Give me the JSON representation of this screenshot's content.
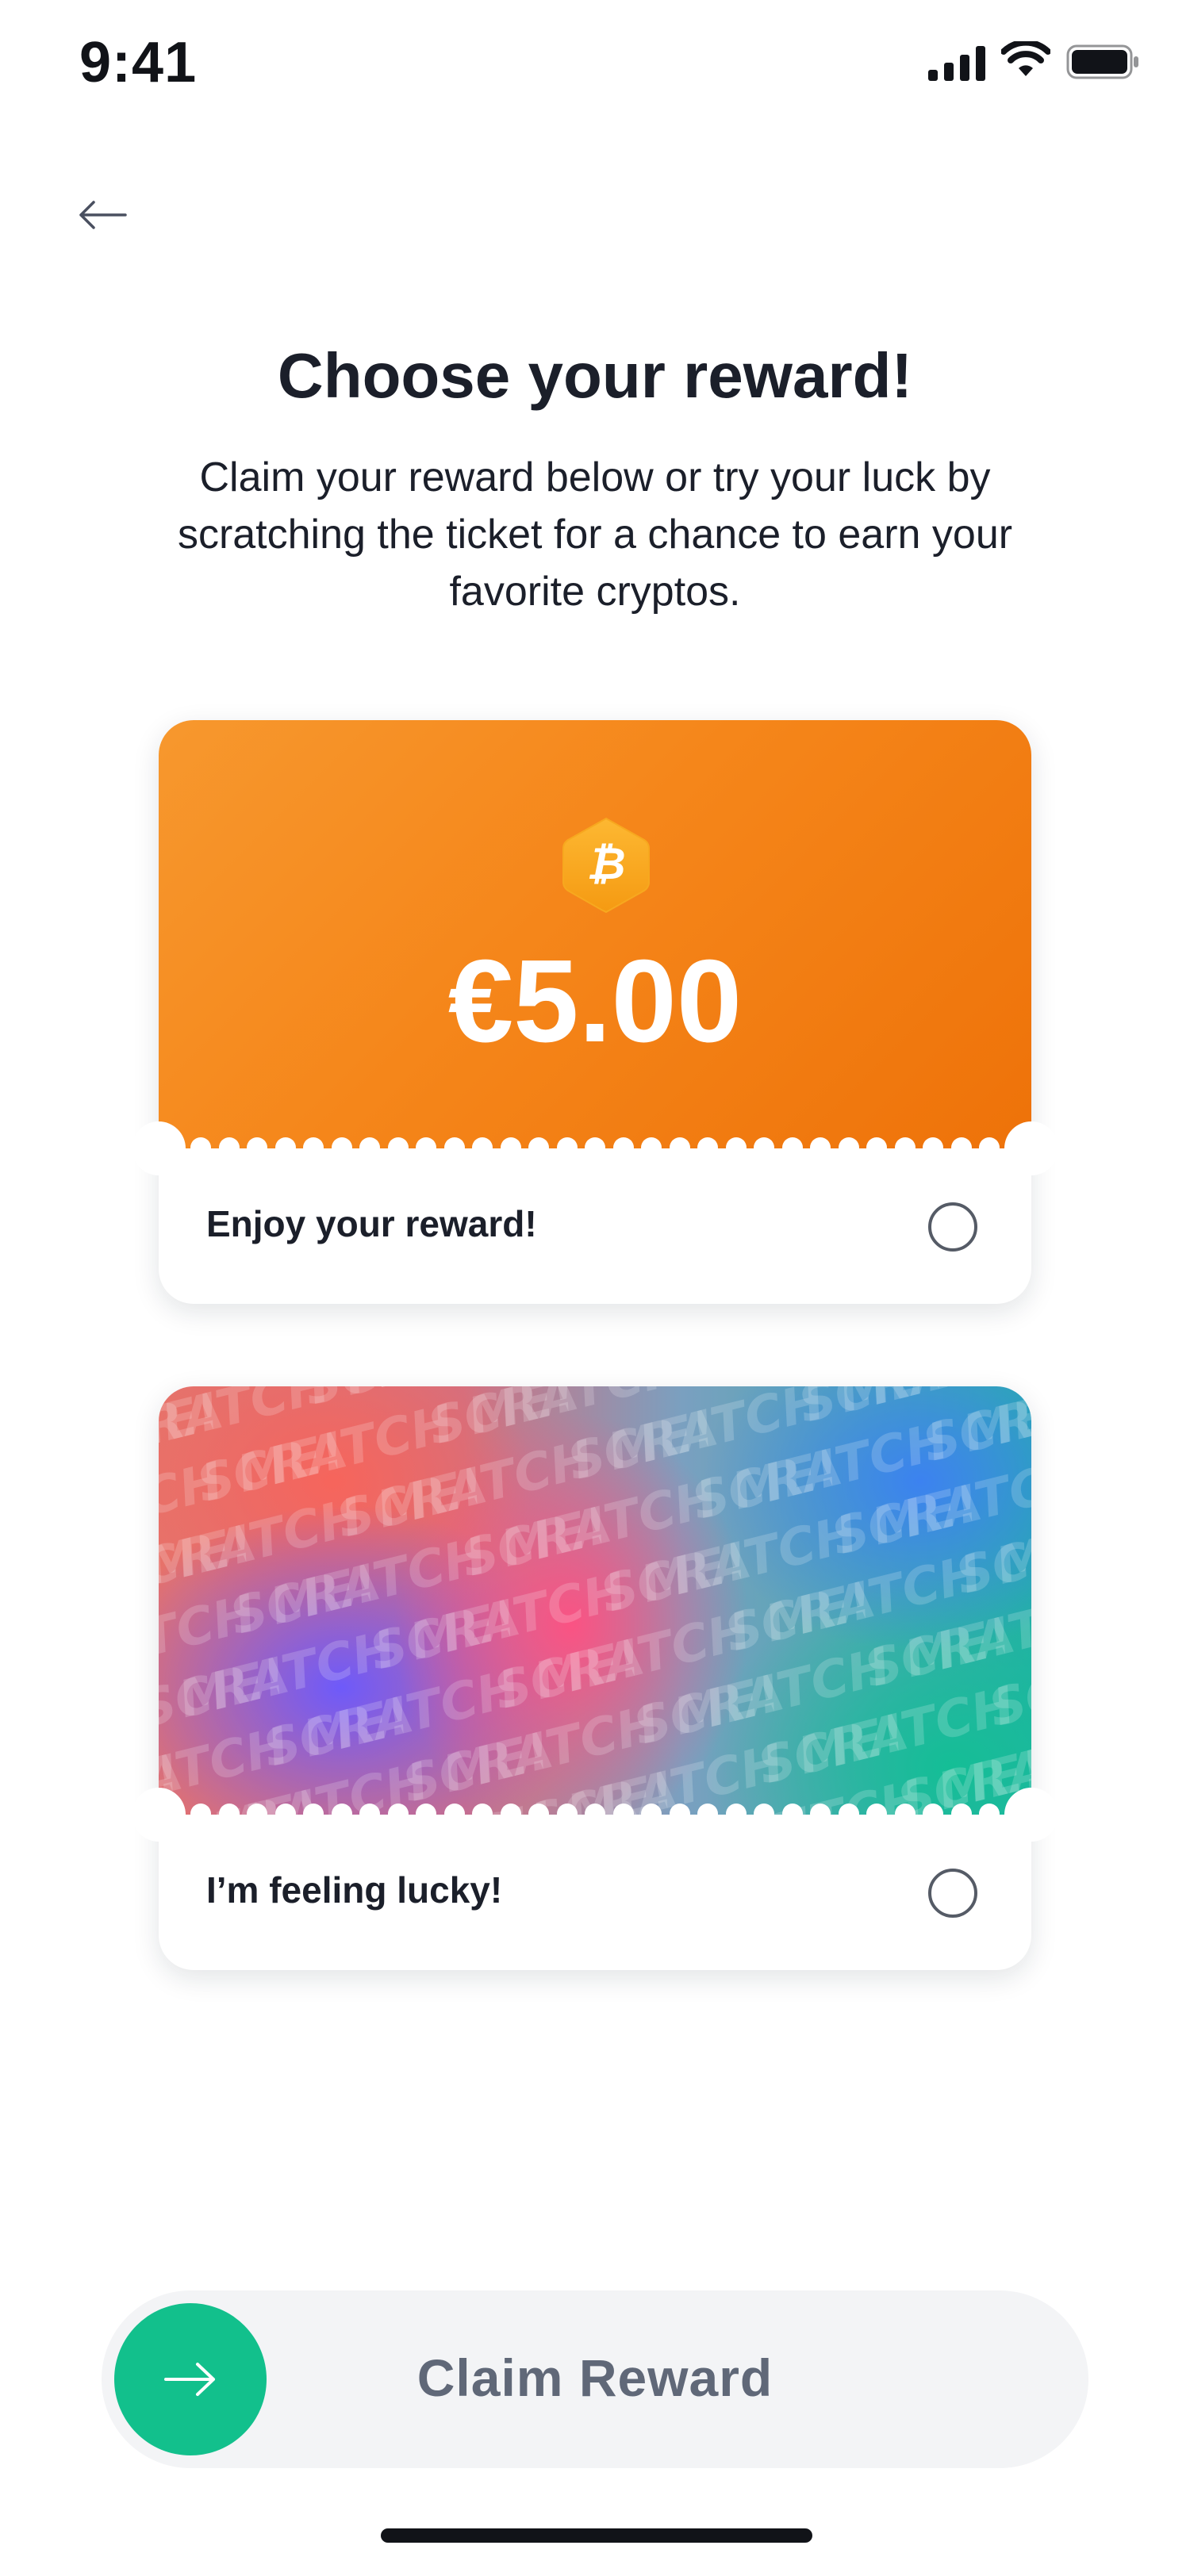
{
  "status_bar": {
    "time": "9:41",
    "icons": [
      "signal-icon",
      "wifi-icon",
      "battery-icon"
    ]
  },
  "nav": {
    "back_icon": "arrow-left-icon"
  },
  "header": {
    "title": "Choose your reward!",
    "subtitle": "Claim your reward below or try your luck by scratching the ticket for a chance to earn your favorite cryptos."
  },
  "reward_ticket": {
    "coin_icon": "bitcoin-icon",
    "amount": "€5.00",
    "label": "Enjoy your reward!",
    "selected": false
  },
  "lucky_ticket": {
    "pattern_text": "SCRATCH ME!",
    "label": "I’m feeling lucky!",
    "selected": false
  },
  "claim": {
    "label": "Claim Reward",
    "knob_icon": "arrow-right-icon"
  },
  "colors": {
    "orange_accent": "#f5861a",
    "green_accent": "#12c08c",
    "text_dark": "#1b1f2a",
    "text_muted": "#606878"
  }
}
